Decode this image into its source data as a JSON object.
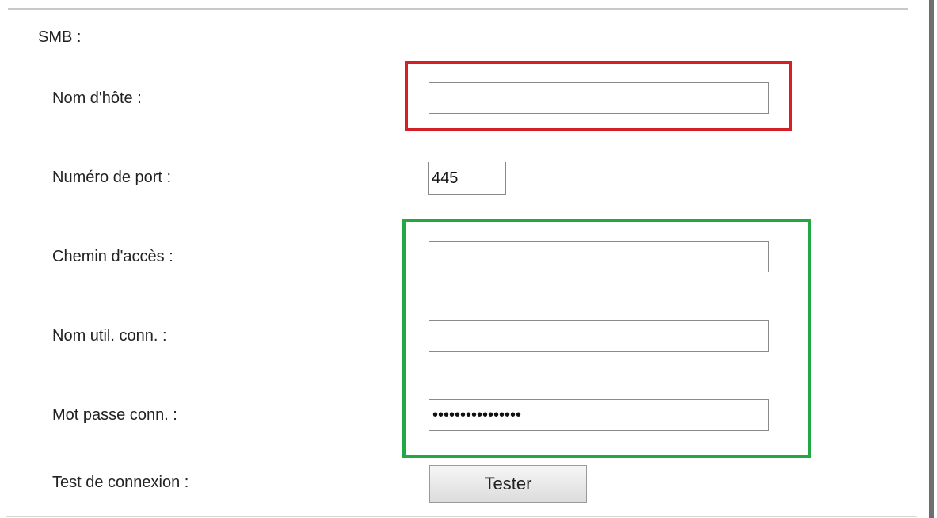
{
  "section": {
    "title": "SMB :"
  },
  "fields": {
    "hostname": {
      "label": "Nom d'hôte :",
      "value": ""
    },
    "port": {
      "label": "Numéro de port :",
      "value": "445"
    },
    "path": {
      "label": "Chemin d'accès :",
      "value": ""
    },
    "username": {
      "label": "Nom util. conn. :",
      "value": ""
    },
    "password": {
      "label": "Mot passe conn. :",
      "value": "••••••••••••••••"
    },
    "test": {
      "label": "Test de connexion :",
      "button_label": "Tester"
    }
  },
  "colors": {
    "highlight_red": "#d42027",
    "highlight_green": "#24a844"
  }
}
